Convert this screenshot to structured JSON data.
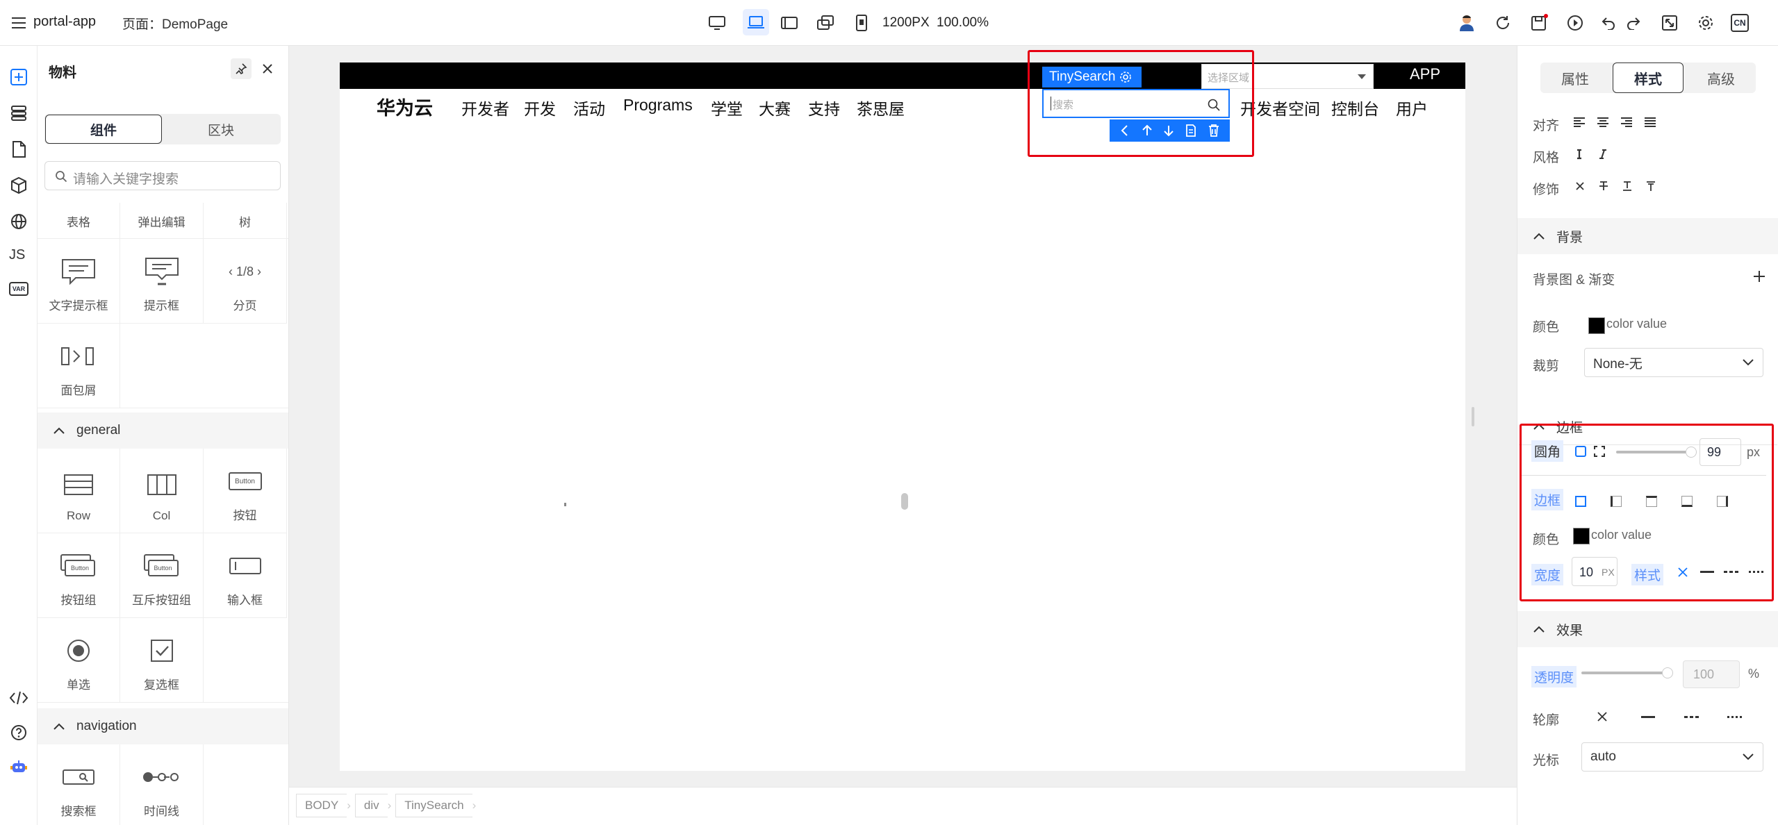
{
  "topbar": {
    "app_name": "portal-app",
    "page_label": "页面：",
    "page_name": "DemoPage",
    "width_text": "1200PX",
    "zoom_text": "100.00%",
    "lang": "CN"
  },
  "activity": {
    "js_label": "JS",
    "var_label": "VAR"
  },
  "left_panel": {
    "title": "物料",
    "tabs": [
      "组件",
      "区块"
    ],
    "search_placeholder": "请输入关键字搜索",
    "top_row": [
      "表格",
      "弹出编辑",
      "树"
    ],
    "row2": [
      {
        "label": "文字提示框",
        "icon": "tooltip-icon"
      },
      {
        "label": "提示框",
        "icon": "popover-icon"
      },
      {
        "label": "分页",
        "icon": "pager-icon",
        "glyph": "1/8"
      }
    ],
    "row3": [
      {
        "label": "面包屑",
        "icon": "breadcrumb-icon"
      }
    ],
    "sections": [
      {
        "title": "general",
        "items": [
          {
            "label": "Row",
            "icon": "row-icon"
          },
          {
            "label": "Col",
            "icon": "col-icon"
          },
          {
            "label": "按钮",
            "icon": "button-icon",
            "glyph": "Button"
          },
          {
            "label": "按钮组",
            "icon": "button-group-icon",
            "glyph": "Button"
          },
          {
            "label": "互斥按钮组",
            "icon": "toggle-button-group-icon",
            "glyph": "Button"
          },
          {
            "label": "输入框",
            "icon": "input-icon"
          },
          {
            "label": "单选",
            "icon": "radio-icon"
          },
          {
            "label": "复选框",
            "icon": "checkbox-icon"
          }
        ]
      },
      {
        "title": "navigation",
        "items": [
          {
            "label": "搜索框",
            "icon": "search-box-icon"
          },
          {
            "label": "时间线",
            "icon": "timeline-icon"
          }
        ]
      }
    ]
  },
  "canvas": {
    "logo": "华为云",
    "nav": [
      "开发者",
      "开发",
      "活动",
      "Programs",
      "学堂",
      "大赛",
      "支持",
      "茶思屋"
    ],
    "right_nav": [
      "开发者空间",
      "控制台",
      "用户"
    ],
    "app_label": "APP",
    "region_placeholder": "选择区域",
    "selected_component": "TinySearch",
    "search_placeholder": "搜索"
  },
  "breadcrumb": [
    "BODY",
    "div",
    "TinySearch"
  ],
  "right_panel": {
    "tabs": [
      "属性",
      "样式",
      "高级"
    ],
    "align_label": "对齐",
    "style_label": "风格",
    "decoration_label": "修饰",
    "background": {
      "title": "背景",
      "image_label": "背景图 & 渐变",
      "color_label": "颜色",
      "color_value": "color value",
      "clip_label": "裁剪",
      "clip_value": "None-无"
    },
    "border": {
      "title": "边框",
      "radius_label": "圆角",
      "radius_value": "99",
      "radius_unit": "px",
      "border_label": "边框",
      "color_label": "颜色",
      "color_value": "color value",
      "width_label": "宽度",
      "width_value": "10",
      "width_unit": "PX",
      "style_label": "样式"
    },
    "effect": {
      "title": "效果",
      "opacity_label": "透明度",
      "opacity_value": "100",
      "opacity_unit": "%",
      "outline_label": "轮廓",
      "cursor_label": "光标",
      "cursor_value": "auto"
    }
  },
  "colors": {
    "accent": "#1476ff",
    "highlight_border": "#e60012",
    "canvas_bg": "#f0f0f0",
    "nav_black": "#000000"
  }
}
